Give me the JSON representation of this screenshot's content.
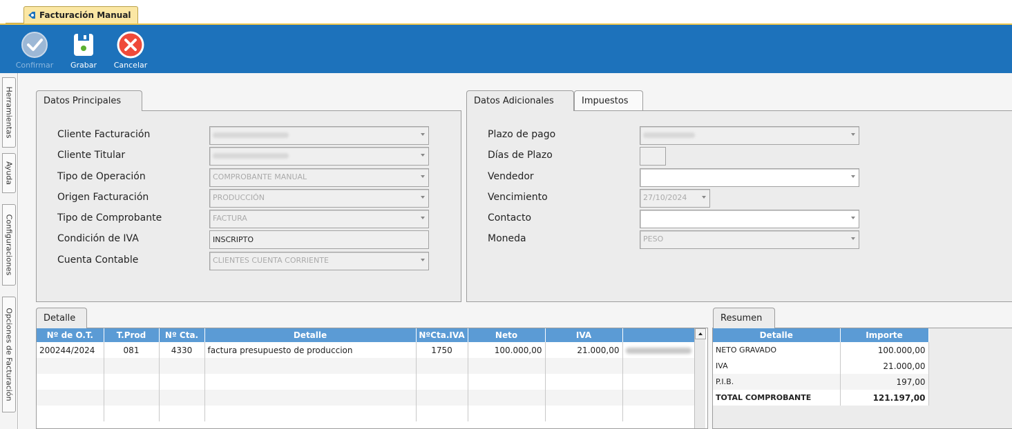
{
  "window": {
    "tab_title": "Facturación Manual"
  },
  "toolbar": {
    "buttons": [
      {
        "label": "Confirmar",
        "icon": "check-circle-icon",
        "enabled": false
      },
      {
        "label": "Grabar",
        "icon": "floppy-disk-icon",
        "enabled": true
      },
      {
        "label": "Cancelar",
        "icon": "cancel-circle-icon",
        "enabled": true
      }
    ],
    "background": "#1d72bb"
  },
  "side_tabs": [
    "Herramientas",
    "Ayuda",
    "Configuraciones",
    "Opciones de Facturación"
  ],
  "principal": {
    "tab_label": "Datos Principales",
    "fields": [
      {
        "label": "Cliente Facturación",
        "value": "",
        "type": "combo",
        "blurred": true
      },
      {
        "label": "Cliente Titular",
        "value": "",
        "type": "combo",
        "blurred": true
      },
      {
        "label": "Tipo de Operación",
        "value": "COMPROBANTE MANUAL",
        "type": "combo"
      },
      {
        "label": "Origen Facturación",
        "value": "PRODUCCIÓN",
        "type": "combo"
      },
      {
        "label": "Tipo de Comprobante",
        "value": "FACTURA",
        "type": "combo"
      },
      {
        "label": "Condición de IVA",
        "value": "INSCRIPTO",
        "type": "text"
      },
      {
        "label": "Cuenta Contable",
        "value": "CLIENTES CUENTA CORRIENTE",
        "type": "combo"
      }
    ]
  },
  "adicionales": {
    "tabs": [
      "Datos Adicionales",
      "Impuestos"
    ],
    "fields": [
      {
        "label": "Plazo de pago",
        "value": "",
        "type": "combo",
        "blurred": true
      },
      {
        "label": "Días de Plazo",
        "value": "",
        "type": "small-text"
      },
      {
        "label": "Vendedor",
        "value": "",
        "type": "combo-enabled"
      },
      {
        "label": "Vencimiento",
        "value": "27/10/2024",
        "type": "date"
      },
      {
        "label": "Contacto",
        "value": "",
        "type": "combo-enabled"
      },
      {
        "label": "Moneda",
        "value": "PESO",
        "type": "combo"
      }
    ]
  },
  "detalle": {
    "tab_label": "Detalle",
    "columns": [
      "Nº de O.T.",
      "T.Prod",
      "Nº Cta.",
      "Detalle",
      "NºCta.IVA",
      "Neto",
      "IVA",
      ""
    ],
    "rows": [
      [
        "200244/2024",
        "081",
        "4330",
        "factura presupuesto de produccion",
        "1750",
        "100.000,00",
        "21.000,00",
        ""
      ]
    ]
  },
  "resumen": {
    "tab_label": "Resumen",
    "columns": [
      "Detalle",
      "Importe"
    ],
    "rows": [
      [
        "NETO GRAVADO",
        "100.000,00"
      ],
      [
        "IVA",
        "21.000,00"
      ],
      [
        "P.I.B.",
        "197,00"
      ],
      [
        "TOTAL COMPROBANTE",
        "121.197,00"
      ]
    ]
  }
}
